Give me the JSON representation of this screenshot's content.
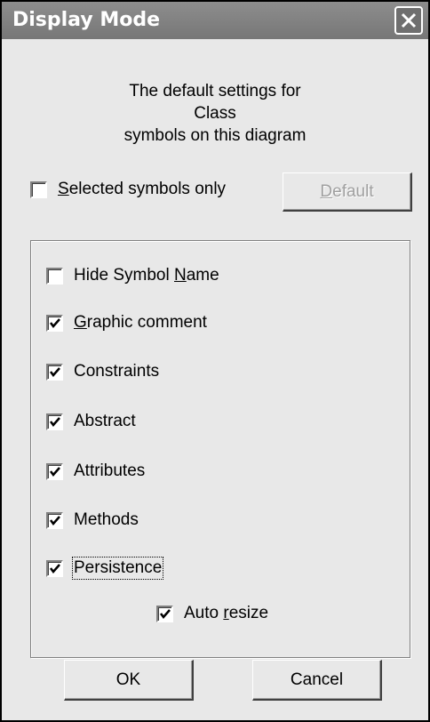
{
  "window": {
    "title": "Display Mode"
  },
  "description": {
    "line1": "The default settings for",
    "line2": "Class",
    "line3": "symbols on this diagram"
  },
  "selected_only": {
    "pre": "",
    "accel": "S",
    "post": "elected symbols only",
    "checked": false
  },
  "default_button": {
    "pre": "",
    "accel": "D",
    "post": "efault",
    "enabled": false
  },
  "options": [
    {
      "pre": "Hide Symbol ",
      "accel": "N",
      "post": "ame",
      "checked": false
    },
    {
      "pre": "",
      "accel": "G",
      "post": "raphic comment",
      "checked": true
    },
    {
      "pre": "Constraints",
      "accel": "",
      "post": "",
      "checked": true
    },
    {
      "pre": "Abstract",
      "accel": "",
      "post": "",
      "checked": true
    },
    {
      "pre": "Attributes",
      "accel": "",
      "post": "",
      "checked": true
    },
    {
      "pre": "Methods",
      "accel": "",
      "post": "",
      "checked": true
    },
    {
      "pre": "Persistence",
      "accel": "",
      "post": "",
      "checked": true,
      "focused": true
    }
  ],
  "auto_resize": {
    "pre": "Auto ",
    "accel": "r",
    "post": "esize",
    "checked": true
  },
  "buttons": {
    "ok": "OK",
    "cancel": "Cancel"
  },
  "icons": {
    "close": "close-icon",
    "check": "checkmark-icon"
  }
}
